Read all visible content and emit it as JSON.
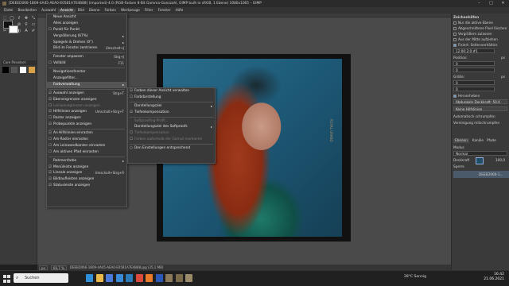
{
  "window": {
    "title": "[DEEED066-1B09-4A45-AEA0-E0581A7E4B88] (imported)-4.0 (RGB-Farben 8-Bit Gamma-Ganzzahl, GIMP built-in sRGB, 1 Ebene) 1080x1065 – GIMP",
    "controls": [
      "–",
      "□",
      "✕"
    ]
  },
  "menubar": [
    "Datei",
    "Bearbeiten",
    "Auswahl",
    "Ansicht",
    "Bild",
    "Ebene",
    "Farben",
    "Werkzeuge",
    "Filter",
    "Fenster",
    "Hilfe"
  ],
  "active_menu": "Ansicht",
  "view_menu": [
    {
      "label": "Neue Ansicht"
    },
    {
      "label": "Alles anzeigen"
    },
    {
      "label": "Punkt für Punkt",
      "icon": "☐"
    },
    {
      "label": "Vergrößerung (67%)",
      "arrow": "▸"
    },
    {
      "label": "Spiegeln & Drehen (0°)",
      "arrow": "▸"
    },
    {
      "label": "Bild im Fenster zentrieren",
      "shortcut": "Umschalt+J"
    },
    {
      "sep": true
    },
    {
      "label": "Fenster anpassen",
      "shortcut": "Strg+J"
    },
    {
      "label": "Vollbild",
      "shortcut": "F11",
      "icon": "☐"
    },
    {
      "sep": true
    },
    {
      "label": "Navigationsfenster"
    },
    {
      "label": "Anzeigefilter..."
    },
    {
      "label": "Farbverwaltung",
      "arrow": "▸",
      "highlight": true
    },
    {
      "sep": true
    },
    {
      "label": "Auswahl anzeigen",
      "shortcut": "Strg+T",
      "icon": "☑"
    },
    {
      "label": "Ebenengrenzen anzeigen",
      "icon": "☑"
    },
    {
      "label": "Leinwandgrenzen anzeigen",
      "disabled": true,
      "icon": "☐"
    },
    {
      "label": "Hilfslinien anzeigen",
      "shortcut": "Umschalt+Strg+T",
      "icon": "☑"
    },
    {
      "label": "Raster anzeigen",
      "icon": "☐"
    },
    {
      "label": "Probepunkte anzeigen",
      "icon": "☑"
    },
    {
      "sep": true
    },
    {
      "label": "An Hilfslinien einrasten",
      "icon": "☑"
    },
    {
      "label": "Am Raster einrasten",
      "icon": "☐"
    },
    {
      "label": "Am Leinwandkanten einrasten",
      "icon": "☐"
    },
    {
      "label": "Am aktiven Pfad einrasten",
      "icon": "☐"
    },
    {
      "sep": true
    },
    {
      "label": "Rahmenfarbe",
      "arrow": "▸"
    },
    {
      "label": "Menüleiste anzeigen",
      "icon": "☑"
    },
    {
      "label": "Lineale anzeigen",
      "shortcut": "Umschalt+Strg+R",
      "icon": "☑"
    },
    {
      "label": "Bildlaufleisten anzeigen",
      "icon": "☑"
    },
    {
      "label": "Statusleiste anzeigen",
      "icon": "☑"
    }
  ],
  "color_menu": [
    {
      "label": "Farben dieser Ansicht verwalten",
      "icon": "☑"
    },
    {
      "label": "Farbdarstellung",
      "icon": "☐"
    },
    {
      "sep": true
    },
    {
      "label": "Darstellungsziel",
      "arrow": "▸"
    },
    {
      "label": "Tiefenkompensation",
      "icon": "☑"
    },
    {
      "sep": true
    },
    {
      "label": "Softproofing-Profil...",
      "disabled": true
    },
    {
      "label": "Darstellungsziel des Softproofs",
      "arrow": "▸"
    },
    {
      "label": "Tiefenkompensation",
      "disabled": true,
      "icon": "☐"
    },
    {
      "label": "Farben außerhalb der Gamut markieren",
      "disabled": true,
      "icon": "☐"
    },
    {
      "sep": true
    },
    {
      "label": "Den Einstellungen entsprechend",
      "icon": "○"
    }
  ],
  "toolbox": {
    "tools": [
      "⬚",
      "◯",
      "ℓ",
      "✥",
      "⤡",
      "⌖",
      "✎",
      "⊘",
      "⚲",
      "▭",
      "✂",
      "⌫",
      "◐",
      "A",
      "✐"
    ],
    "brushes_title": "Core Pinselset",
    "brush_colors": [
      "#000000",
      "#555555",
      "#ffffff",
      "#d9a14a"
    ]
  },
  "photo_caption": "ROYAL GRAND",
  "statusbar": {
    "unit": "px",
    "zoom": "66,7 %",
    "file": "DEEED066-1B09-4A45-AEA0-E0581A7E4B88.jpg (35,1 MB)"
  },
  "dock": {
    "title": "Zeichenhilfen",
    "options": [
      {
        "label": "Nur die aktive Ebene",
        "on": false
      },
      {
        "label": "Abgeschnittene Pixel löschen",
        "on": false
      },
      {
        "label": "Vergrößern zulassen",
        "on": false
      },
      {
        "label": "Aus der Mitte aufziehen",
        "on": false
      },
      {
        "label": "Fixiert: Seitenverhältnis",
        "on": true
      }
    ],
    "ratio": "12:00:2:0:#1",
    "pos_label": "Position:",
    "pos_unit": "px",
    "pos_values": [
      "0",
      "0"
    ],
    "size_label": "Größe:",
    "size_unit": "px",
    "size_values": [
      "0",
      "0"
    ],
    "highlight": "Hervorheben",
    "highlight_val": "Abdunkeln Deckkraft: 50.0",
    "guides": "Keine Hilfslinien",
    "auto_shrink": "Automatisch schrumpfen",
    "merge": "Vereinigung mitschrumpfen",
    "tabs": [
      "Ebenen",
      "Kanäle",
      "Pfade"
    ],
    "mode_label": "Modus",
    "mode_value": "Normal",
    "opacity_label": "Deckkraft",
    "opacity_value": "100,0",
    "lock_label": "Sperre",
    "layer_name": "DEEED066-1..."
  },
  "taskbar": {
    "search": "Suchen",
    "weather": "28°C Sonnig",
    "time": "16:42",
    "date": "21.06.2021",
    "apps": [
      {
        "name": "edge",
        "color": "#2f8ed8"
      },
      {
        "name": "explorer",
        "color": "#e8b84a"
      },
      {
        "name": "store",
        "color": "#4a7ad8"
      },
      {
        "name": "mail",
        "color": "#3a8ad8"
      },
      {
        "name": "photos",
        "color": "#2a7ab8"
      },
      {
        "name": "chrome",
        "color": "#d84a3a"
      },
      {
        "name": "firefox",
        "color": "#e87a2a"
      },
      {
        "name": "word",
        "color": "#2a5ab8"
      },
      {
        "name": "gimp1",
        "color": "#8a7a5a"
      },
      {
        "name": "gimp2",
        "color": "#7a6a4a"
      },
      {
        "name": "gimp3",
        "color": "#9a8a6a"
      }
    ]
  }
}
